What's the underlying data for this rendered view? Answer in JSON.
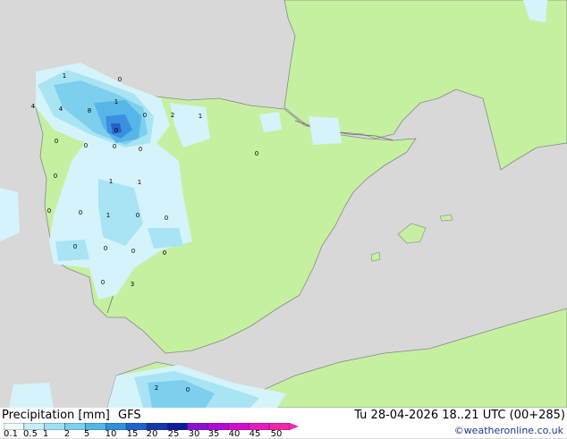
{
  "map": {
    "sea_color": "#d8d8d8",
    "land_color": "#c5f0a0",
    "precip_colors": [
      "#d5f3fa",
      "#a9e4f4",
      "#7dcfee",
      "#57b6e8",
      "#3a8fe0",
      "#2a5ec8"
    ],
    "contour_labels": [
      "1",
      "0",
      "4",
      "4",
      "8",
      "1",
      "0",
      "0",
      "2",
      "0",
      "0",
      "0",
      "0",
      "0",
      "1",
      "0",
      "1",
      "1",
      "0",
      "0",
      "1",
      "0",
      "0",
      "0",
      "0",
      "0",
      "0",
      "0",
      "3",
      "2",
      "0"
    ]
  },
  "legend": {
    "title": "Precipitation [mm]",
    "model": "GFS",
    "datetime": "Tu 28-04-2026 18..21 UTC (00+285)",
    "credit": "©weatheronline.co.uk",
    "scale_labels": [
      "0.1",
      "0.5",
      "1",
      "2",
      "5",
      "10",
      "15",
      "20",
      "25",
      "30",
      "35",
      "40",
      "45",
      "50"
    ],
    "scale_colors": [
      "#f0fbfe",
      "#c8eef8",
      "#a0e0f2",
      "#7ad0ee",
      "#50b8e6",
      "#3090e0",
      "#1e64d0",
      "#1438b0",
      "#0c1aa0",
      "#8a10d8",
      "#b00ad8",
      "#d40ad0",
      "#e818c0",
      "#f028a8"
    ]
  }
}
